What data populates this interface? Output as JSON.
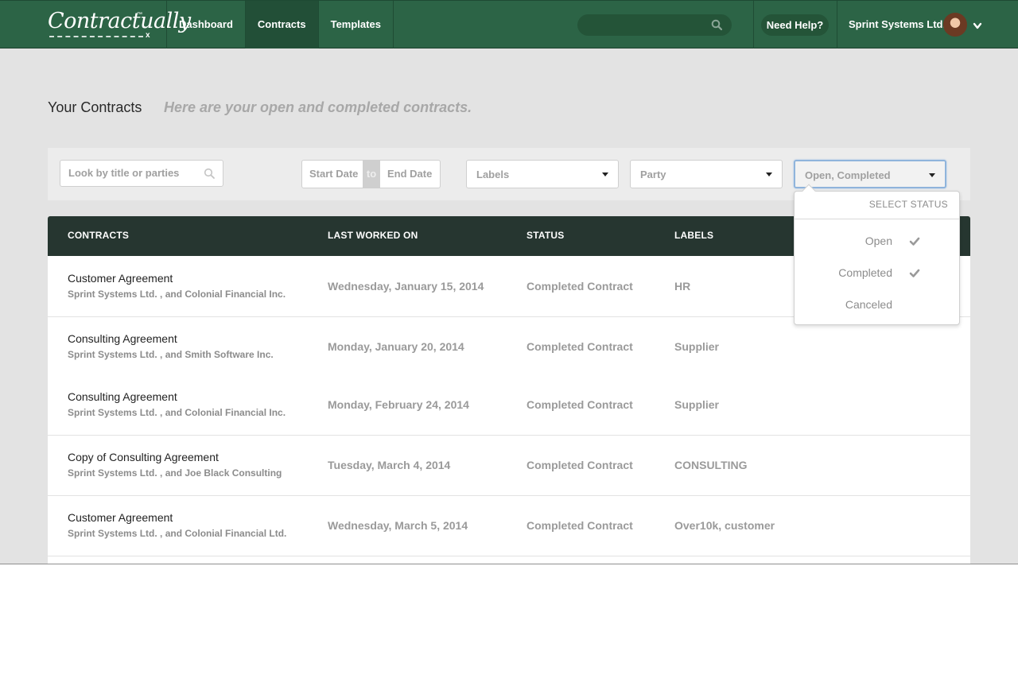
{
  "topbar": {
    "logo_text": "Contractually",
    "logo_tm": "™",
    "logo_x": "x",
    "nav": [
      {
        "label": "Dashboard"
      },
      {
        "label": "Contracts"
      },
      {
        "label": "Templates"
      }
    ],
    "help_label": "Need Help?",
    "account_name": "Sprint Systems Ltd."
  },
  "header": {
    "title": "Your Contracts",
    "subtitle": "Here are your open and completed contracts."
  },
  "filters": {
    "search_placeholder": "Look by title or parties",
    "start_date_placeholder": "Start Date",
    "date_to": "to",
    "end_date_placeholder": "End Date",
    "labels_select": "Labels",
    "party_select": "Party",
    "status_select": "Open, Completed"
  },
  "table": {
    "headers": [
      "CONTRACTS",
      "LAST WORKED ON",
      "STATUS",
      "LABELS"
    ],
    "rows": [
      {
        "title": "Customer Agreement",
        "parties": "Sprint Systems Ltd. , and Colonial Financial Inc.",
        "date": "Wednesday, January 15, 2014",
        "status": "Completed Contract",
        "labels": "HR"
      },
      {
        "title": "Consulting Agreement",
        "parties": "Sprint Systems Ltd. , and Smith Software Inc.",
        "date": "Monday, January 20, 2014",
        "status": "Completed Contract",
        "labels": "Supplier"
      },
      {
        "title": "Consulting Agreement",
        "parties": "Sprint Systems Ltd. , and Colonial Financial Inc.",
        "date": "Monday, February 24, 2014",
        "status": "Completed Contract",
        "labels": "Supplier"
      },
      {
        "title": "Copy of Consulting Agreement",
        "parties": "Sprint Systems Ltd. , and Joe Black Consulting",
        "date": "Tuesday, March 4, 2014",
        "status": "Completed Contract",
        "labels": "CONSULTING"
      },
      {
        "title": "Customer Agreement",
        "parties": "Sprint Systems Ltd. , and Colonial Financial Ltd.",
        "date": "Wednesday, March 5, 2014",
        "status": "Completed Contract",
        "labels": "Over10k, customer"
      }
    ]
  },
  "status_dropdown": {
    "heading": "SELECT STATUS",
    "options": [
      {
        "label": "Open",
        "checked": true
      },
      {
        "label": "Completed",
        "checked": true
      },
      {
        "label": "Canceled",
        "checked": false
      }
    ]
  },
  "colors": {
    "topbar": "#2c6446",
    "table_header": "#263630",
    "page_bg": "#e3e3e3"
  }
}
